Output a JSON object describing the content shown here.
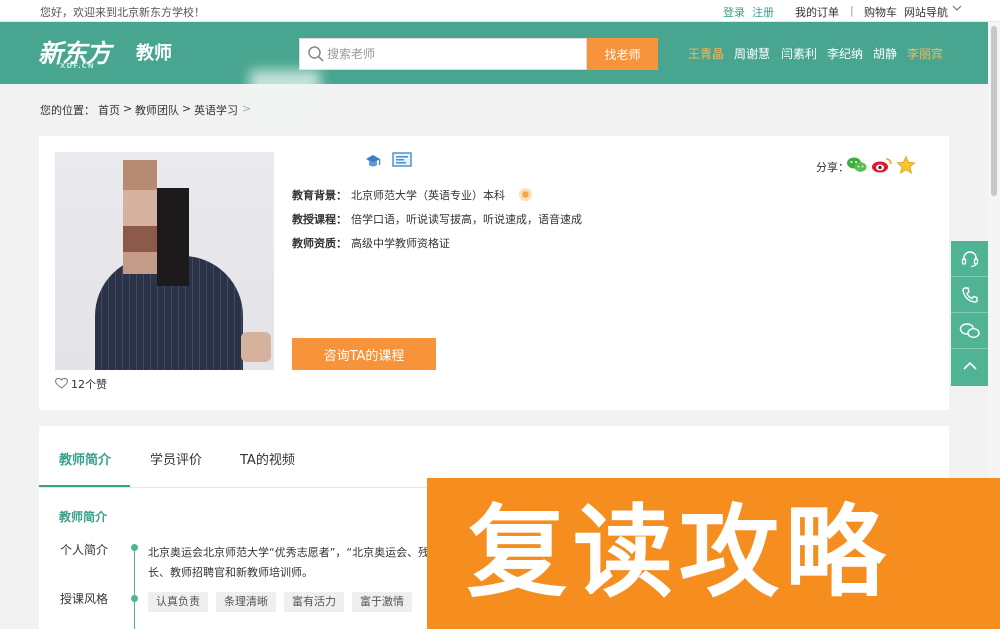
{
  "topbar": {
    "welcome": "您好，欢迎来到北京新东方学校！",
    "login": "登录",
    "register": "注册",
    "orders": "我的订单",
    "separator": "|",
    "cart": "购物车",
    "site_nav": "网站导航"
  },
  "header": {
    "logo_cn": "新东方",
    "logo_en": "XDF.CN",
    "section_title": "教师",
    "search_placeholder": "搜索老师",
    "search_button": "找老师",
    "hot_teachers": [
      "王青晶",
      "周谢慧",
      "闫素利",
      "李纪纳",
      "胡静",
      "李丽宾"
    ]
  },
  "breadcrumb": {
    "label": "您的位置：",
    "items": [
      "首页",
      "教师团队",
      "英语学习"
    ],
    "sep": ">"
  },
  "profile": {
    "education_label": "教育背景：",
    "education_value": "北京师范大学（英语专业）本科",
    "courses_label": "教授课程：",
    "courses_value": "倍学口语，听说读写拔高，听说速成，语音速成",
    "qualification_label": "教师资质：",
    "qualification_value": "高级中学教师资格证",
    "consult_button": "咨询TA的课程",
    "likes": "12个赞",
    "share_label": "分享："
  },
  "tabs": [
    "教师简介",
    "学员评价",
    "TA的视频"
  ],
  "intro": {
    "section_title": "教师简介",
    "personal_label": "个人简介",
    "bio_line1": "北京奥运会北京师范大学“优秀志愿者”，“北京奥运会、残",
    "bio_line2": "长、教师招聘官和新教师培训师。",
    "style_label": "授课风格",
    "style_tags": [
      "认真负责",
      "条理清晰",
      "富有活力",
      "富于激情"
    ]
  },
  "overlay_text": "复读攻略",
  "colors": {
    "brand_green": "#48a58f",
    "accent_orange": "#f7933a",
    "overlay_orange": "#f58d1f"
  }
}
